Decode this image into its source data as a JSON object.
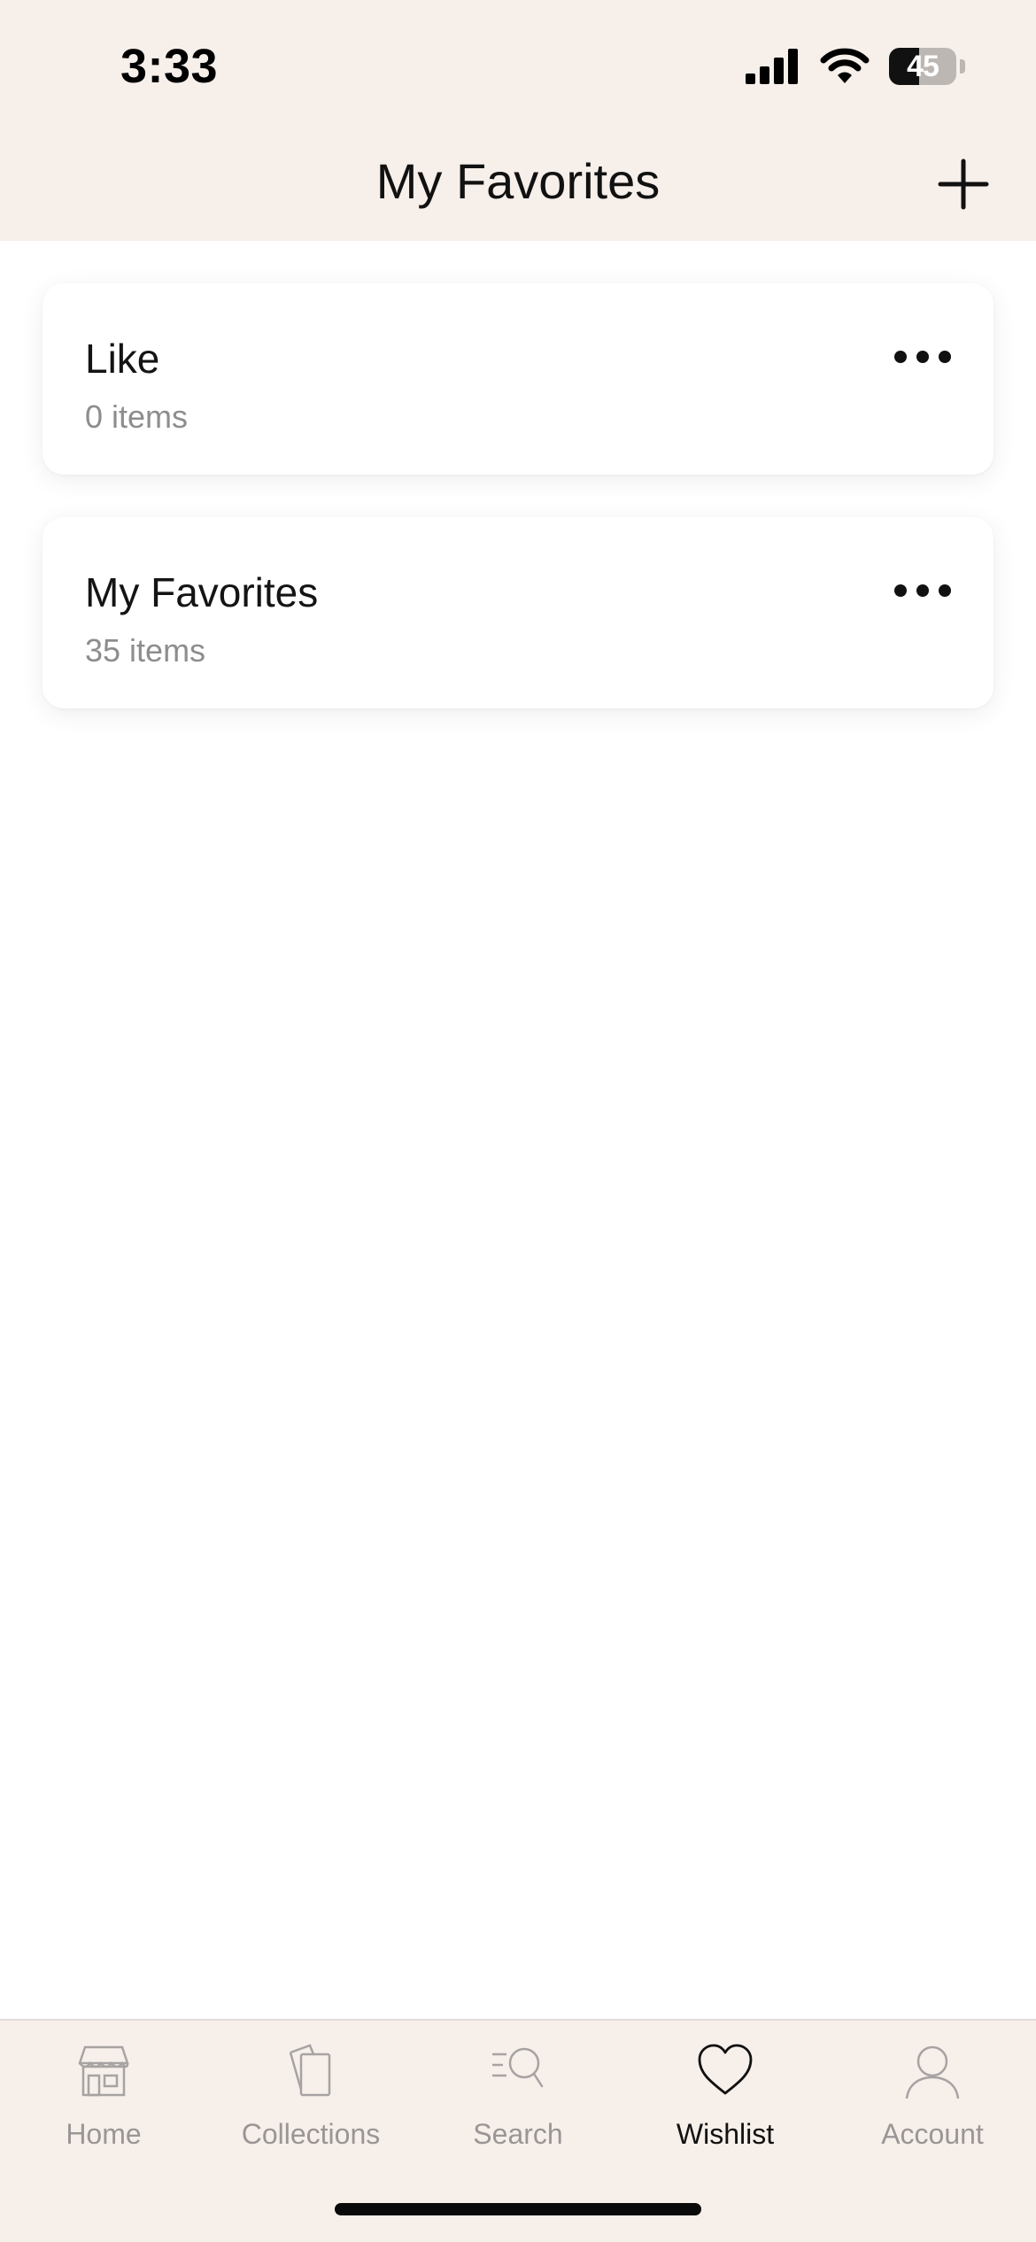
{
  "status_bar": {
    "time": "3:33",
    "battery": 45,
    "icons": [
      "signal-icon",
      "wifi-icon",
      "battery-icon"
    ]
  },
  "header": {
    "title": "My Favorites",
    "add_icon": "plus-icon"
  },
  "lists": [
    {
      "title": "Like",
      "count": "0 items"
    },
    {
      "title": "My Favorites",
      "count": "35 items"
    }
  ],
  "tabbar": {
    "items": [
      {
        "label": "Home",
        "icon": "storefront-icon",
        "active": false
      },
      {
        "label": "Collections",
        "icon": "collections-icon",
        "active": false
      },
      {
        "label": "Search",
        "icon": "search-icon",
        "active": false
      },
      {
        "label": "Wishlist",
        "icon": "heart-icon",
        "active": true
      },
      {
        "label": "Account",
        "icon": "person-icon",
        "active": false
      }
    ]
  },
  "colors": {
    "header_bg": "#f7efea",
    "active_tab": "#111111",
    "inactive_tab": "#9a9696"
  }
}
